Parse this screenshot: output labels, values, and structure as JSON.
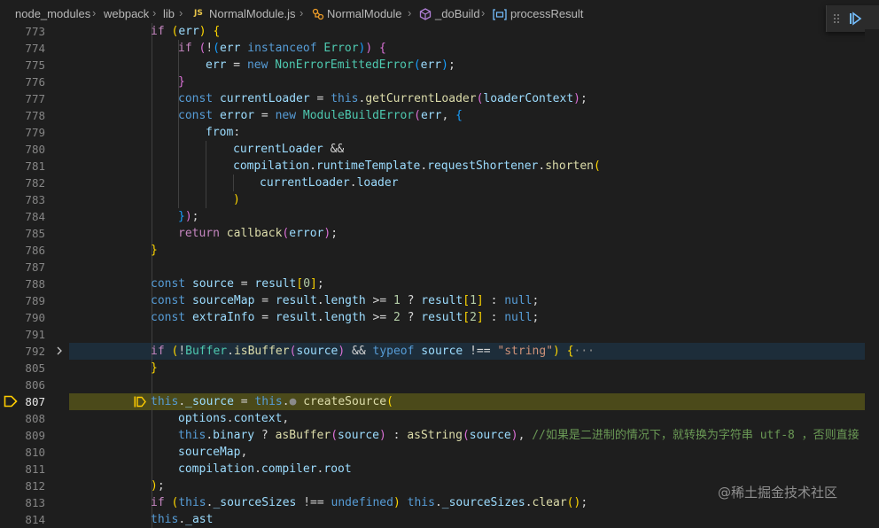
{
  "breadcrumb": {
    "items": [
      "node_modules",
      "webpack",
      "lib",
      "NormalModule.js",
      "NormalModule",
      "_doBuild",
      "processResult"
    ],
    "file_badge": "JS",
    "separator": "›"
  },
  "debug_toolbar": {
    "icons": [
      "drag-handle-icon",
      "continue-icon"
    ]
  },
  "editor": {
    "current_line": "807",
    "folded_line": "792",
    "folded_ellipsis": "···",
    "lines": [
      {
        "n": "773",
        "indent": 3
      },
      {
        "n": "774",
        "indent": 4
      },
      {
        "n": "775",
        "indent": 5
      },
      {
        "n": "776",
        "indent": 4
      },
      {
        "n": "777",
        "indent": 4
      },
      {
        "n": "778",
        "indent": 4
      },
      {
        "n": "779",
        "indent": 5
      },
      {
        "n": "780",
        "indent": 6
      },
      {
        "n": "781",
        "indent": 6
      },
      {
        "n": "782",
        "indent": 7
      },
      {
        "n": "783",
        "indent": 6
      },
      {
        "n": "784",
        "indent": 4
      },
      {
        "n": "785",
        "indent": 4
      },
      {
        "n": "786",
        "indent": 3
      },
      {
        "n": "787",
        "indent": 0
      },
      {
        "n": "788",
        "indent": 3
      },
      {
        "n": "789",
        "indent": 3
      },
      {
        "n": "790",
        "indent": 3
      },
      {
        "n": "791",
        "indent": 0
      },
      {
        "n": "792",
        "indent": 3
      },
      {
        "n": "805",
        "indent": 3
      },
      {
        "n": "806",
        "indent": 0
      },
      {
        "n": "807",
        "indent": 3
      },
      {
        "n": "808",
        "indent": 4
      },
      {
        "n": "809",
        "indent": 4
      },
      {
        "n": "810",
        "indent": 4
      },
      {
        "n": "811",
        "indent": 4
      },
      {
        "n": "812",
        "indent": 3
      },
      {
        "n": "813",
        "indent": 3
      },
      {
        "n": "814",
        "indent": 3
      }
    ],
    "code": {
      "l773": "if (err) {",
      "l774": "if (!(err instanceof Error)) {",
      "l775": "err = new NonErrorEmittedError(err);",
      "l776": "}",
      "l777": "const currentLoader = this.getCurrentLoader(loaderContext);",
      "l778": "const error = new ModuleBuildError(err, {",
      "l779": "from:",
      "l780": "currentLoader &&",
      "l781": "compilation.runtimeTemplate.requestShortener.shorten(",
      "l782": "currentLoader.loader",
      "l783": ")",
      "l784": "});",
      "l785": "return callback(error);",
      "l786": "}",
      "l788": "const source = result[0];",
      "l789": "const sourceMap = result.length >= 1 ? result[1] : null;",
      "l790": "const extraInfo = result.length >= 2 ? result[2] : null;",
      "l792": "if (!Buffer.isBuffer(source) && typeof source !== \"string\") {",
      "l805": "}",
      "l807": "this._source = this.createSource(",
      "l808": "options.context,",
      "l809": "this.binary ? asBuffer(source) : asString(source), //如果是二进制的情况下，就转换为字符串 utf-8 ，否则直接",
      "l810": "sourceMap,",
      "l811": "compilation.compiler.root",
      "l812": ");",
      "l813": "if (this._sourceSizes !== undefined) this._sourceSizes.clear();",
      "l814": "this._ast"
    }
  },
  "watermark": "@稀土掘金技术社区",
  "colors": {
    "background": "#1e1e1e",
    "current_line_highlight": "#4b4a1a",
    "breakpoint_arrow": "#ffcc00"
  }
}
